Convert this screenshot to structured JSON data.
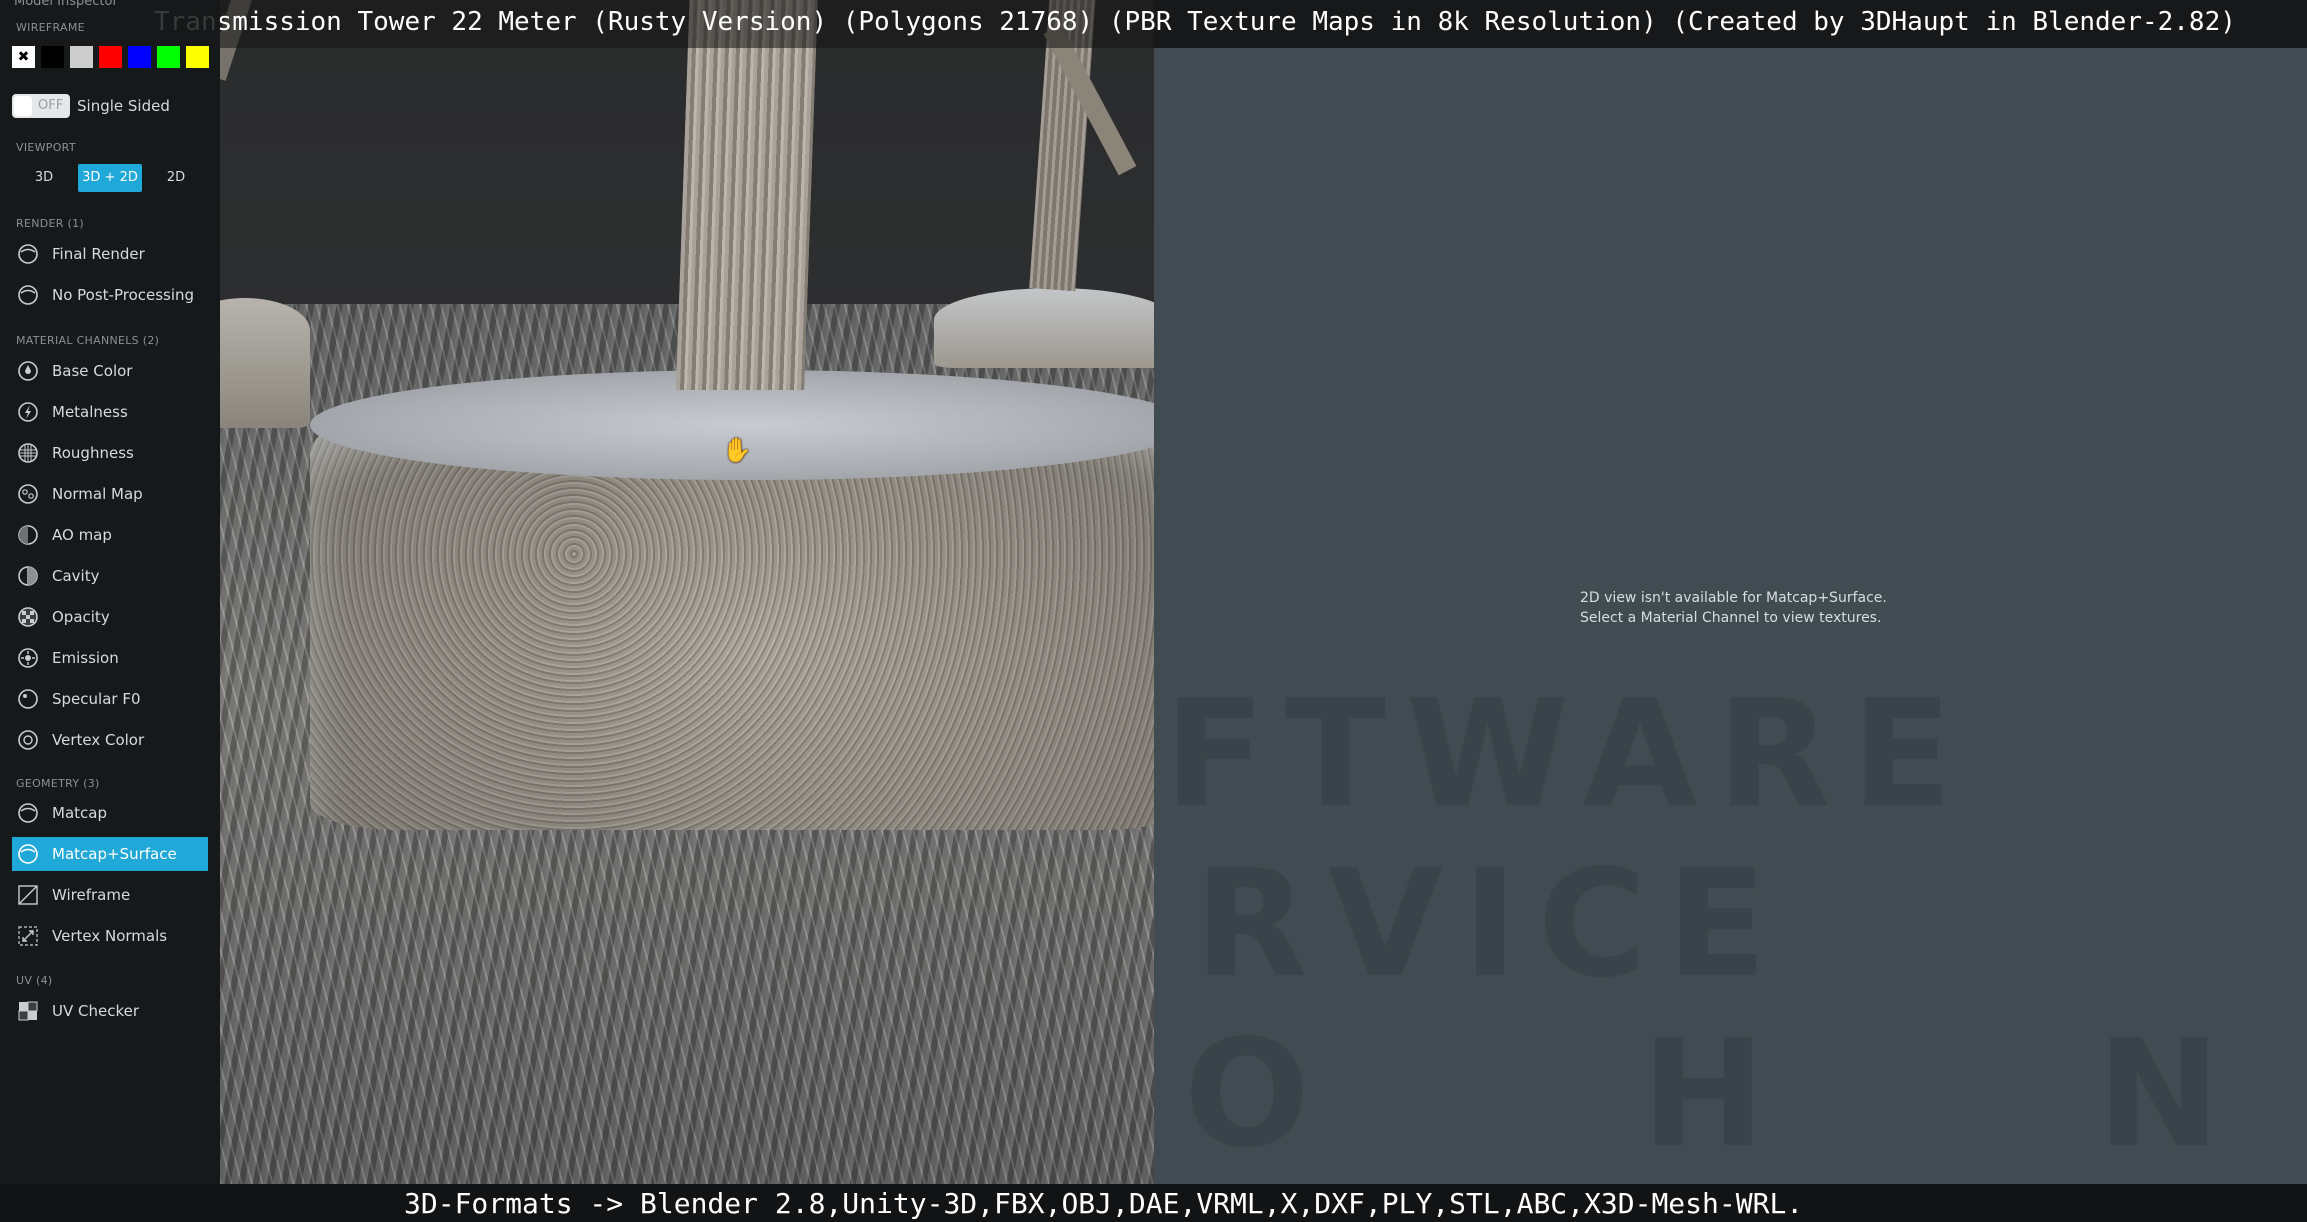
{
  "window": {
    "title": "Transmission Tower 22 Meter (Rusty Version) (Polygons 21768) (PBR Texture Maps in 8k Resolution) (Created by 3DHaupt in Blender-2.82)"
  },
  "footer": {
    "text": "3D-Formats -> Blender 2.8,Unity-3D,FBX,OBJ,DAE,VRML,X,DXF,PLY,STL,ABC,X3D-Mesh-WRL."
  },
  "sidebar": {
    "inspector_label": "Model Inspector",
    "wireframe_label": "WIREFRAME",
    "wireframe_swatches": [
      {
        "name": "none",
        "color": "#ffffff",
        "icon": "close-icon"
      },
      {
        "name": "black",
        "color": "#000000"
      },
      {
        "name": "light-gray",
        "color": "#cccccc"
      },
      {
        "name": "red",
        "color": "#ff0000"
      },
      {
        "name": "blue",
        "color": "#0000ff"
      },
      {
        "name": "green",
        "color": "#00ff00"
      },
      {
        "name": "yellow",
        "color": "#ffff00"
      }
    ],
    "single_sided": {
      "toggle_state": "OFF",
      "label": "Single Sided"
    },
    "viewport": {
      "label": "VIEWPORT",
      "options": [
        "3D",
        "3D + 2D",
        "2D"
      ],
      "selected": "3D + 2D"
    },
    "render": {
      "label": "RENDER (1)",
      "items": [
        {
          "label": "Final Render",
          "icon": "render-sphere-icon"
        },
        {
          "label": "No Post-Processing",
          "icon": "render-sphere-icon"
        }
      ]
    },
    "material_channels": {
      "label": "MATERIAL CHANNELS (2)",
      "items": [
        {
          "label": "Base Color",
          "icon": "base-color-icon"
        },
        {
          "label": "Metalness",
          "icon": "metalness-icon"
        },
        {
          "label": "Roughness",
          "icon": "roughness-icon"
        },
        {
          "label": "Normal Map",
          "icon": "normal-map-icon"
        },
        {
          "label": "AO map",
          "icon": "ao-map-icon"
        },
        {
          "label": "Cavity",
          "icon": "cavity-icon"
        },
        {
          "label": "Opacity",
          "icon": "opacity-icon"
        },
        {
          "label": "Emission",
          "icon": "emission-icon"
        },
        {
          "label": "Specular F0",
          "icon": "specular-icon"
        },
        {
          "label": "Vertex Color",
          "icon": "vertex-color-icon"
        }
      ]
    },
    "geometry": {
      "label": "GEOMETRY (3)",
      "items": [
        {
          "label": "Matcap",
          "icon": "matcap-icon"
        },
        {
          "label": "Matcap+Surface",
          "icon": "matcap-surface-icon",
          "active": true
        },
        {
          "label": "Wireframe",
          "icon": "wireframe-icon"
        },
        {
          "label": "Vertex Normals",
          "icon": "vertex-normals-icon"
        }
      ]
    },
    "uv": {
      "label": "UV (4)",
      "items": [
        {
          "label": "UV Checker",
          "icon": "uv-checker-icon"
        }
      ]
    }
  },
  "panel2d": {
    "message_line1": "2D view isn't available for Matcap+Surface.",
    "message_line2": "Select a Material Channel to view textures.",
    "watermark_lines": [
      "FTWARE",
      "RVICE",
      "O H N"
    ]
  },
  "colors": {
    "accent": "#1fa8d8",
    "sidebar_bg": "#16181a",
    "panel2d_bg": "#414c52"
  }
}
